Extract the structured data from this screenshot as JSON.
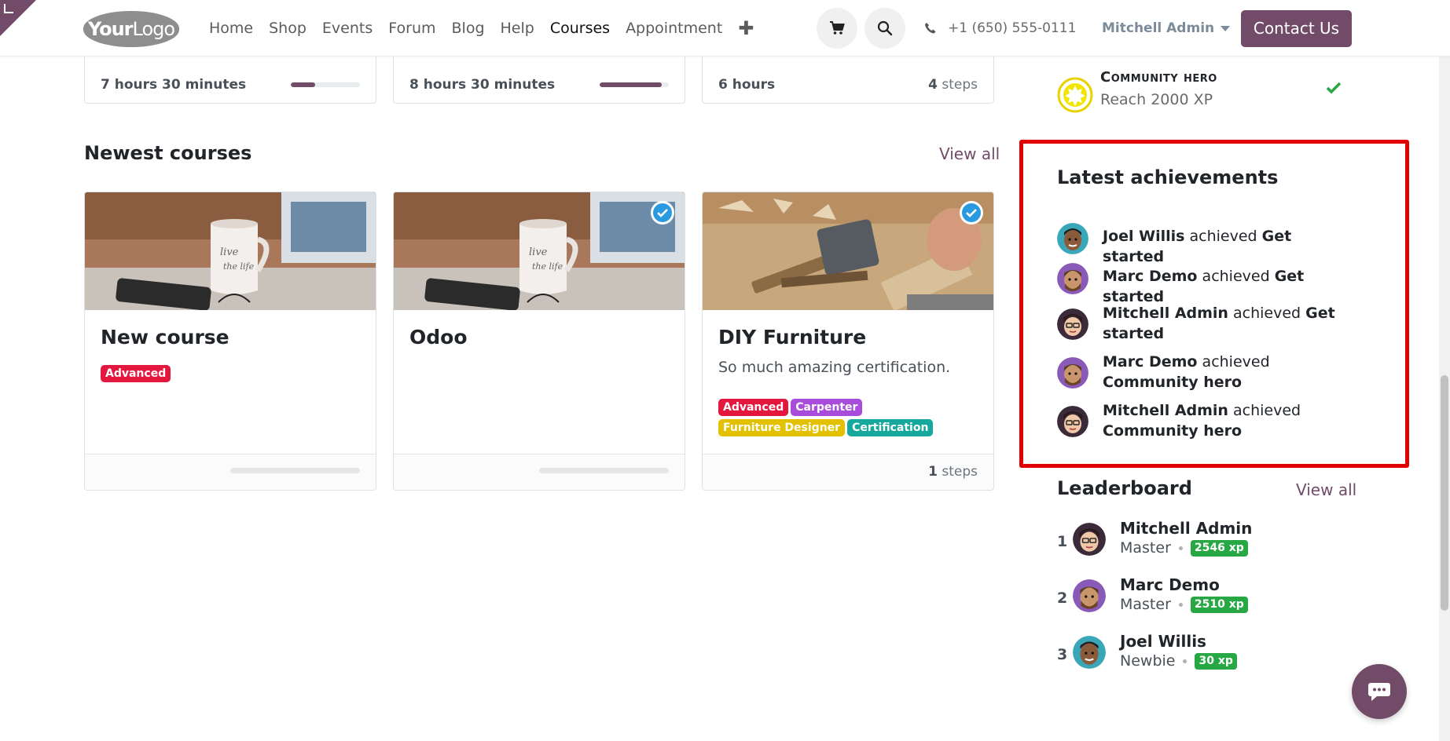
{
  "header": {
    "logo_text_bold": "Your",
    "logo_text": "Logo",
    "nav": [
      "Home",
      "Shop",
      "Events",
      "Forum",
      "Blog",
      "Help",
      "Courses",
      "Appointment"
    ],
    "active_nav": "Courses",
    "phone": "+1 (650) 555-0111",
    "user": "Mitchell Admin",
    "contact_label": "Contact Us"
  },
  "top_cards": [
    {
      "duration": "7 hours 30 minutes",
      "progress": 0.35
    },
    {
      "duration": "8 hours 30 minutes",
      "progress": 0.9
    },
    {
      "duration": "6 hours",
      "steps_count": "4",
      "steps_label": "steps"
    }
  ],
  "newest": {
    "title": "Newest courses",
    "view_all": "View all",
    "courses": [
      {
        "title": "New course",
        "description": "",
        "tags": [
          {
            "label": "Advanced",
            "color": "#e4173e"
          }
        ],
        "verified": false
      },
      {
        "title": "Odoo",
        "description": "",
        "tags": [],
        "verified": true
      },
      {
        "title": "DIY Furniture",
        "description": "So much amazing certification.",
        "tags": [
          {
            "label": "Advanced",
            "color": "#e4173e"
          },
          {
            "label": "Carpenter",
            "color": "#a84cdb"
          },
          {
            "label": "Furniture Designer",
            "color": "#e3c100"
          },
          {
            "label": "Certification",
            "color": "#16a89c"
          }
        ],
        "verified": true,
        "steps_count": "1",
        "steps_label": "steps"
      }
    ]
  },
  "badge": {
    "title": "Community hero",
    "description": "Reach 2000 XP"
  },
  "achievements": {
    "title": "Latest achievements",
    "connector": "achieved",
    "items": [
      {
        "user": "Joel Willis",
        "badge": "Get started"
      },
      {
        "user": "Marc Demo",
        "badge": "Get started"
      },
      {
        "user": "Mitchell Admin",
        "badge": "Get started"
      },
      {
        "user": "Marc Demo",
        "badge": "Community hero"
      },
      {
        "user": "Mitchell Admin",
        "badge": "Community hero"
      }
    ]
  },
  "leaderboard": {
    "title": "Leaderboard",
    "view_all": "View all",
    "items": [
      {
        "rank": "1",
        "name": "Mitchell Admin",
        "level": "Master",
        "xp": "2546 xp"
      },
      {
        "rank": "2",
        "name": "Marc Demo",
        "level": "Master",
        "xp": "2510 xp"
      },
      {
        "rank": "3",
        "name": "Joel Willis",
        "level": "Newbie",
        "xp": "30 xp"
      }
    ]
  },
  "colors": {
    "brand": "#714b67",
    "xp_green": "#28a745",
    "highlight": "#e00000"
  }
}
